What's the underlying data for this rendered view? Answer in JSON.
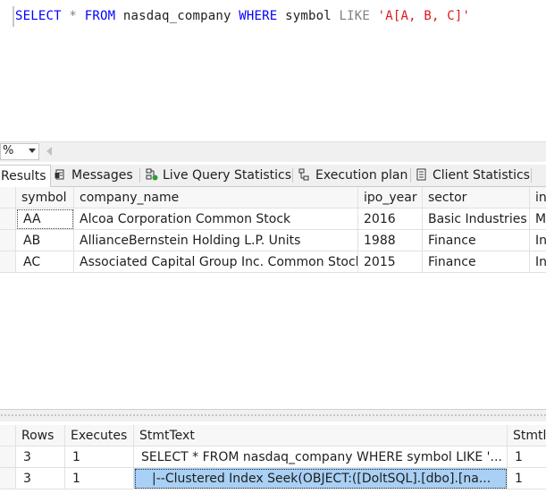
{
  "editor": {
    "sql_tokens": [
      {
        "text": "SELECT",
        "cls": "kw"
      },
      {
        "text": " ",
        "cls": "ident"
      },
      {
        "text": "*",
        "cls": "op"
      },
      {
        "text": " ",
        "cls": "ident"
      },
      {
        "text": "FROM",
        "cls": "kw"
      },
      {
        "text": " nasdaq_company ",
        "cls": "ident"
      },
      {
        "text": "WHERE",
        "cls": "kw"
      },
      {
        "text": " symbol ",
        "cls": "ident"
      },
      {
        "text": "LIKE",
        "cls": "op"
      },
      {
        "text": " ",
        "cls": "ident"
      },
      {
        "text": "'A[A, B, C]'",
        "cls": "str"
      }
    ]
  },
  "zoom": {
    "value": "%"
  },
  "tabs": [
    {
      "label": "Results",
      "icon": "results-grid-icon",
      "active": true
    },
    {
      "label": "Messages",
      "icon": "messages-icon",
      "active": false
    },
    {
      "label": "Live Query Statistics",
      "icon": "live-query-statistics-icon",
      "active": false
    },
    {
      "label": "Execution plan",
      "icon": "execution-plan-icon",
      "active": false
    },
    {
      "label": "Client Statistics",
      "icon": "client-statistics-icon",
      "active": false
    }
  ],
  "results": {
    "columns": [
      "symbol",
      "company_name",
      "ipo_year",
      "sector",
      "ind"
    ],
    "rows": [
      [
        "AA",
        "Alcoa Corporation Common Stock",
        "2016",
        "Basic Industries",
        "M"
      ],
      [
        "AB",
        "AllianceBernstein Holding L.P.  Units",
        "1988",
        "Finance",
        "In"
      ],
      [
        "AC",
        "Associated Capital Group Inc. Common Stock",
        "2015",
        "Finance",
        "In"
      ]
    ]
  },
  "stats": {
    "columns": [
      "Rows",
      "Executes",
      "StmtText",
      "StmtId"
    ],
    "column_labels_visible": [
      "Rows",
      "Executes",
      "StmtText",
      "Stmtlc"
    ],
    "rows": [
      [
        "3",
        "1",
        "SELECT * FROM nasdaq_company WHERE symbol LIKE '...",
        "1"
      ],
      [
        "3",
        "1",
        "|--Clustered Index Seek(OBJECT:([DoltSQL].[dbo].[na...",
        "1"
      ]
    ]
  },
  "colors": {
    "keyword": "#0000ff",
    "string": "#e0171c",
    "operator": "#808080",
    "selection": "#a9d0f5"
  }
}
